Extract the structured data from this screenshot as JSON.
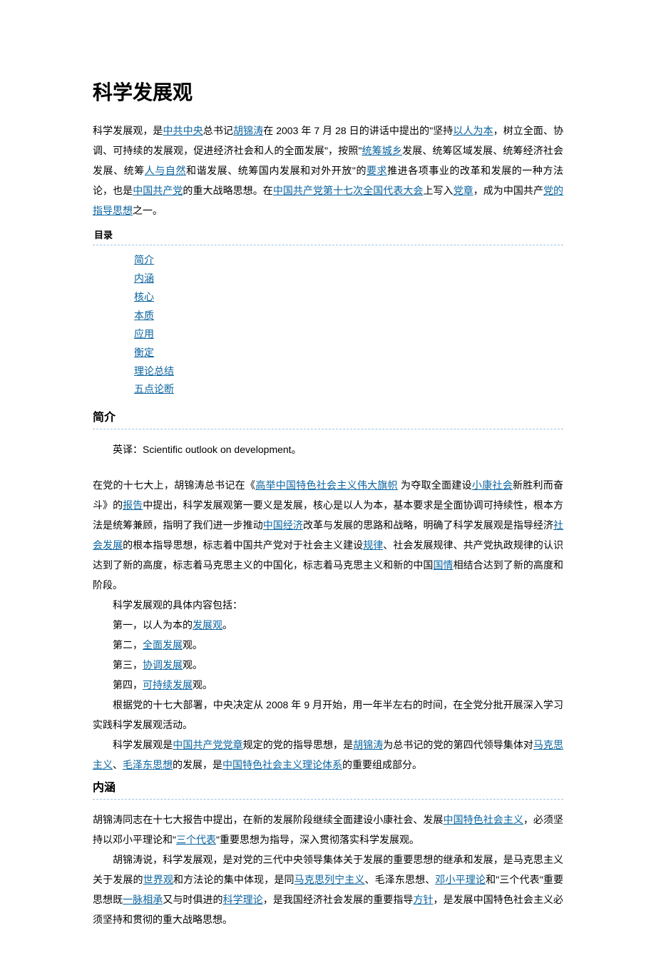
{
  "title": "科学发展观",
  "intro": {
    "t1": "科学发展观，是",
    "l1": "中共中央",
    "t2": "总书记",
    "l2": "胡锦涛",
    "t3": "在 2003 年 7 月 28 日的讲话中提出的\"坚持",
    "l3": "以人为本",
    "t4": "，树立全面、协调、可持续的发展观，促进经济社会和人的全面发展\"，按照\"",
    "l4": "统筹城乡",
    "t5": "发展、统筹区域发展、统筹经济社会发展、统筹",
    "l5": "人与自然",
    "t6": "和谐发展、统筹国内发展和对外开放\"的",
    "l6": "要求",
    "t7": "推进各项事业的改革和发展的一种方法论，也是",
    "l7": "中国共产党",
    "t8": "的重大战略思想。在",
    "l8": "中国共产党第十七次全国代表大会",
    "t9": "上写入",
    "l9": "党章",
    "t10": "，成为中国共产",
    "l10": "党的指导思想",
    "t11": "之一。"
  },
  "toc_label": "目录",
  "toc": [
    "简介",
    "内涵",
    "核心",
    "本质",
    "应用",
    "衡定",
    "理论总结",
    "五点论断"
  ],
  "sec1_heading": "简介",
  "eng": "英译：Scientific outlook on development。",
  "p1": {
    "t1": "在党的十七大上，胡锦涛总书记在《",
    "l1": "高举中国特色社会主义伟大旗帜",
    "t2": " 为夺取全面建设",
    "l2": "小康社会",
    "t3": "新胜利而奋斗》的",
    "l3": "报告",
    "t4": "中提出，科学发展观第一要义是发展，核心是以人为本，基本要求是全面协调可持续性，根本方法是统筹兼顾，指明了我们进一步推动",
    "l4": "中国经济",
    "t5": "改革与发展的思路和战略，明确了科学发展观是指导经济",
    "l5": "社会发展",
    "t6": "的根本指导思想，标志着中国共产党对于社会主义建设",
    "l6": "规律",
    "t7": "、社会发展规律、共产党执政规律的认识达到了新的高度，标志着马克思主义的中国化，标志着马克思主义和新的中国",
    "l7": "国情",
    "t8": "相结合达到了新的高度和阶段。"
  },
  "content_label": "科学发展观的具体内容包括：",
  "items": {
    "i1a": "第一，以人为本的",
    "i1l": "发展观",
    "i1b": "。",
    "i2a": "第二，",
    "i2l": "全面发展",
    "i2b": "观。",
    "i3a": "第三，",
    "i3l": "协调发展",
    "i3b": "观。",
    "i4a": "第四，",
    "i4l": "可持续发展",
    "i4b": "观。"
  },
  "p2": "根据党的十七大部署，中央决定从 2008 年 9 月开始，用一年半左右的时间，在全党分批开展深入学习实践科学发展观活动。",
  "p3": {
    "t1": "科学发展观是",
    "l1": "中国共产党党章",
    "t2": "规定的党的指导思想，是",
    "l2": "胡锦涛",
    "t3": "为总书记的党的第四代领导集体对",
    "l3": "马克思主义",
    "t4": "、",
    "l4": "毛泽东思想",
    "t5": "的发展，是",
    "l5": "中国特色社会主义理论体系",
    "t6": "的重要组成部分。"
  },
  "sec2_heading": "内涵",
  "p4": {
    "t1": "胡锦涛同志在十七大报告中提出，在新的发展阶段继续全面建设小康社会、发展",
    "l1": "中国特色社会主义",
    "t2": "，必须坚持以邓小平理论和\"",
    "l2": "三个代表",
    "t3": "\"重要思想为指导，深入贯彻落实科学发展观。"
  },
  "p5": {
    "t1": "胡锦涛说，科学发展观，是对党的三代中央领导集体关于发展的重要思想的继承和发展，是马克思主义关于发展的",
    "l1": "世界观",
    "t2": "和方法论的集中体现，是同",
    "l2": "马克思列宁主义",
    "t3": "、毛泽东思想、",
    "l3": "邓小平理论",
    "t4": "和\"三个代表\"重要思想既",
    "l4": "一脉相承",
    "t5": "又与时俱进的",
    "l5": "科学理论",
    "t6": "，是我国经济社会发展的重要指导",
    "l6": "方针",
    "t7": "，是发展中国特色社会主义必须坚持和贯彻的重大战略思想。"
  }
}
